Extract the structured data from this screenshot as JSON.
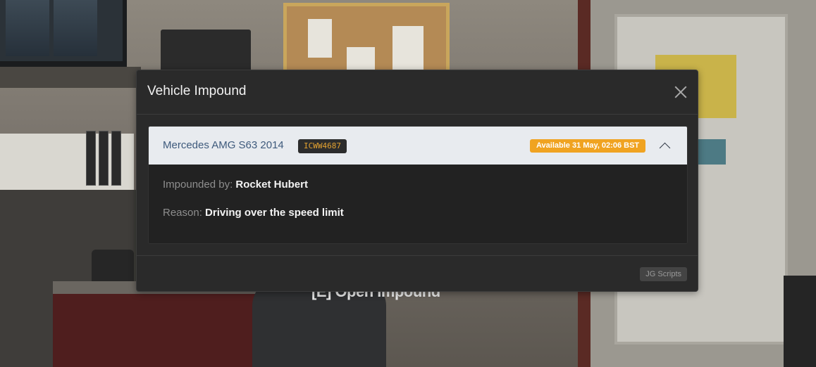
{
  "background": {
    "prompt_text": "[E] Open Impound"
  },
  "modal": {
    "title": "Vehicle Impound",
    "close_icon": "close-icon"
  },
  "vehicle": {
    "name": "Mercedes AMG S63 2014",
    "plate": "ICWW4687",
    "availability": "Available 31 May, 02:06 BST",
    "expanded": true,
    "impounded_by_label": "Impounded by:",
    "impounded_by_value": "Rocket Hubert",
    "reason_label": "Reason:",
    "reason_value": "Driving over the speed limit"
  },
  "footer": {
    "brand": "JG Scripts"
  },
  "colors": {
    "accent_orange": "#f0a321",
    "plate_text": "#e3a230",
    "header_bg": "#e8ebef",
    "modal_bg": "#2a2a2a"
  }
}
